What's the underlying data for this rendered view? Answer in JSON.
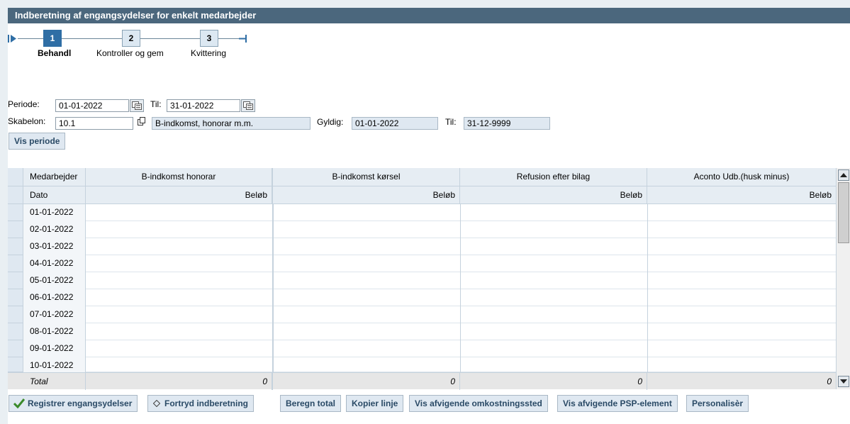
{
  "title": "Indberetning af engangsydelser for enkelt medarbejder",
  "roadmap": {
    "steps": [
      {
        "number": "1",
        "label": "Behandl"
      },
      {
        "number": "2",
        "label": "Kontroller og gem"
      },
      {
        "number": "3",
        "label": "Kvittering"
      }
    ],
    "active_step": "1"
  },
  "form": {
    "periode_label": "Periode:",
    "periode_from": "01-01-2022",
    "til_label": "Til:",
    "periode_to": "31-01-2022",
    "skabelon_label": "Skabelon:",
    "skabelon_value": "10.1",
    "skabelon_desc": "B-indkomst, honorar m.m.",
    "gyldig_label": "Gyldig:",
    "gyldig_from": "01-01-2022",
    "til2_label": "Til:",
    "gyldig_to": "31-12-9999",
    "vis_periode_button": "Vis periode"
  },
  "table": {
    "first_col_header": "Medarbejder",
    "first_col_sub": "Dato",
    "columns": [
      {
        "header": "B-indkomst honorar",
        "sub": "Beløb",
        "total": "0"
      },
      {
        "header": "B-indkomst kørsel",
        "sub": "Beløb",
        "total": "0"
      },
      {
        "header": "Refusion efter bilag",
        "sub": "Beløb",
        "total": "0"
      },
      {
        "header": "Aconto Udb.(husk minus)",
        "sub": "Beløb",
        "total": "0"
      }
    ],
    "rows": [
      "01-01-2022",
      "02-01-2022",
      "03-01-2022",
      "04-01-2022",
      "05-01-2022",
      "06-01-2022",
      "07-01-2022",
      "08-01-2022",
      "09-01-2022",
      "10-01-2022"
    ],
    "total_label": "Total"
  },
  "buttons": {
    "registrer": "Registrer engangsydelser",
    "fortryd": "Fortryd indberetning",
    "beregn": "Beregn total",
    "kopier": "Kopier linje",
    "vis_omk": "Vis afvigende omkostningssted",
    "vis_psp": "Vis afvigende PSP-element",
    "personaliser": "Personalisèr"
  },
  "colors": {
    "titlebar": "#4b677d",
    "active_step": "#2f6ea5",
    "button_text": "#2a4a66",
    "check": "#3a8a2a"
  }
}
